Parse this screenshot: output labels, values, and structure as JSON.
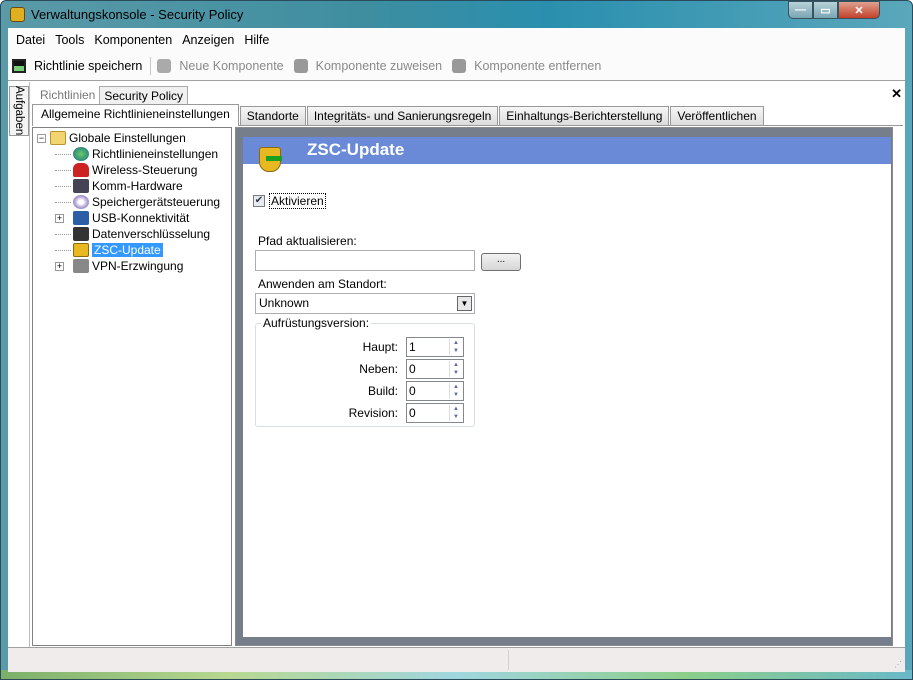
{
  "window": {
    "title": "Verwaltungskonsole - Security Policy",
    "controls": {
      "minimize": "—",
      "maximize": "▭",
      "close": "✕"
    }
  },
  "menu": [
    "Datei",
    "Tools",
    "Komponenten",
    "Anzeigen",
    "Hilfe"
  ],
  "toolbar": {
    "save": "Richtlinie speichern",
    "new_component": "Neue Komponente",
    "assign_component": "Komponente zuweisen",
    "remove_component": "Komponente entfernen"
  },
  "side_tab": "Aufgaben",
  "doc_tabs": [
    "Richtlinien",
    "Security Policy"
  ],
  "doc_close": "✕",
  "tabs": [
    "Allgemeine Richtlinieneinstellungen",
    "Standorte",
    "Integritäts- und Sanierungsregeln",
    "Einhaltungs-Berichterstellung",
    "Veröffentlichen"
  ],
  "tree": {
    "root": "Globale Einstellungen",
    "items": [
      "Richtlinieneinstellungen",
      "Wireless-Steuerung",
      "Komm-Hardware",
      "Speichergerätsteuerung",
      "USB-Konnektivität",
      "Datenverschlüsselung",
      "ZSC-Update",
      "VPN-Erzwingung"
    ],
    "selected": "ZSC-Update"
  },
  "panel": {
    "title": "ZSC-Update",
    "enable_label": "Aktivieren",
    "enable_checked": true,
    "path_label": "Pfad aktualisieren:",
    "path_value": "",
    "browse": "...",
    "location_label": "Anwenden am Standort:",
    "location_value": "Unknown",
    "version_group": "Aufrüstungsversion:",
    "version": [
      {
        "label": "Haupt:",
        "value": "1"
      },
      {
        "label": "Neben:",
        "value": "0"
      },
      {
        "label": "Build:",
        "value": "0"
      },
      {
        "label": "Revision:",
        "value": "0"
      }
    ]
  },
  "colors": {
    "header": "#6a8ad8",
    "selection": "#3399ff",
    "panel_bg": "#767e8c"
  }
}
